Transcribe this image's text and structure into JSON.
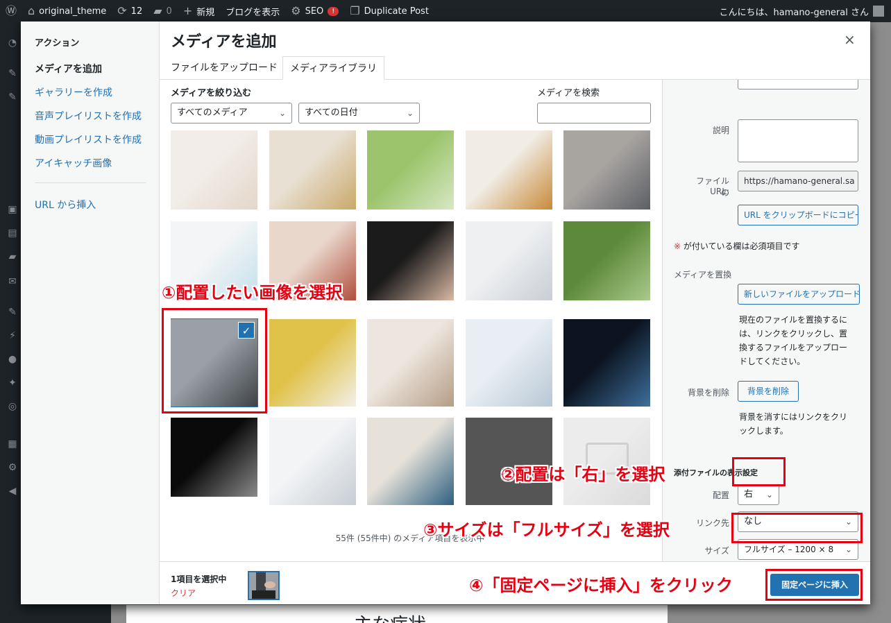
{
  "adminbar": {
    "site_name": "original_theme",
    "updates": "12",
    "comments": "0",
    "new_label": "新規",
    "view_blog": "ブログを表示",
    "seo_label": "SEO",
    "seo_badge": "!",
    "duplicate_post": "Duplicate Post",
    "greeting": "こんにちは、hamano-general さん"
  },
  "modal": {
    "title": "メディアを追加",
    "close": "×",
    "tabs": [
      {
        "label": "ファイルをアップロード"
      },
      {
        "label": "メディアライブラリ"
      }
    ]
  },
  "menu": {
    "heading": "アクション",
    "items": [
      {
        "label": "メディアを追加"
      },
      {
        "label": "ギャラリーを作成"
      },
      {
        "label": "音声プレイリストを作成"
      },
      {
        "label": "動画プレイリストを作成"
      },
      {
        "label": "アイキャッチ画像"
      },
      {
        "label": "URL から挿入"
      }
    ]
  },
  "filters": {
    "label": "メディアを絞り込む",
    "media_type": "すべてのメディア",
    "date": "すべての日付",
    "search_label": "メディアを検索",
    "search_value": ""
  },
  "library": {
    "count_text": "55件 (55件中) のメディア項目を表示中",
    "thumbnails": [
      {
        "name": "woman-sneezing",
        "colors": [
          "#f2ede8",
          "#e4d6c9"
        ]
      },
      {
        "name": "man-stairs-back-pain",
        "colors": [
          "#e8e0d2",
          "#c9a86a"
        ]
      },
      {
        "name": "elderly-man-walking",
        "colors": [
          "#9cc46c",
          "#d7e8c4"
        ]
      },
      {
        "name": "beer-and-food",
        "colors": [
          "#f1ece4",
          "#c78a3a"
        ]
      },
      {
        "name": "arm-closeup",
        "colors": [
          "#a8a4a0",
          "#5c5f66"
        ]
      },
      {
        "name": "man-jogging",
        "colors": [
          "#f3f5f7",
          "#c2e0ea"
        ]
      },
      {
        "name": "woman-eating",
        "colors": [
          "#e9d7cc",
          "#b04e3c"
        ]
      },
      {
        "name": "belly-dark",
        "colors": [
          "#1b1b1b",
          "#d9b9a5"
        ]
      },
      {
        "name": "blood-pressure",
        "colors": [
          "#eef0f2",
          "#c9ced4"
        ]
      },
      {
        "name": "couple-jogging",
        "colors": [
          "#5d8a3a",
          "#a9c98c"
        ]
      },
      {
        "name": "man-holding-stomach",
        "colors": [
          "#9aa0a6",
          "#3e4247"
        ]
      },
      {
        "name": "woman-mask-fever",
        "colors": [
          "#e0c24a",
          "#f3efe9"
        ]
      },
      {
        "name": "child-mask",
        "colors": [
          "#ede6de",
          "#b59d86"
        ]
      },
      {
        "name": "ct-scanner-room",
        "colors": [
          "#e8eef3",
          "#b8c8d6"
        ]
      },
      {
        "name": "brain-mri",
        "colors": [
          "#0b1420",
          "#3f6f9c"
        ]
      },
      {
        "name": "ct-scan-slices",
        "colors": [
          "#0a0a0a",
          "#8a8a8a"
        ]
      },
      {
        "name": "ct-machine",
        "colors": [
          "#f2f4f6",
          "#c7cdd3"
        ]
      },
      {
        "name": "hospital-corridor",
        "colors": [
          "#e7e2d9",
          "#2d5f80"
        ]
      },
      {
        "name": "gray-placeholder",
        "colors": [
          "#555555",
          "#555555"
        ]
      },
      {
        "name": "image-placeholder",
        "colors": [
          "#ececec",
          "#dadada"
        ]
      }
    ]
  },
  "sidebar": {
    "description_label": "説明",
    "file_url_label_1": "ファイルの",
    "file_url_label_2": "URL:",
    "file_url_value": "https://hamano-general.sa",
    "copy_url_button": "URL をクリップボードにコピー",
    "required_star": "※",
    "required_note": "が付いている欄は必須項目です",
    "replace_media_label": "メディアを置換",
    "upload_new_button": "新しいファイルをアップロード",
    "replace_desc_1": "現在のファイルを置換するに",
    "replace_desc_2": "は、リンクをクリックし、置",
    "replace_desc_3": "換するファイルをアップロー",
    "replace_desc_4": "ドしてください。",
    "remove_bg_label": "背景を削除",
    "remove_bg_button": "背景を削除",
    "remove_bg_desc_1": "背景を消すにはリンクをクリ",
    "remove_bg_desc_2": "ックします。",
    "display_settings_title": "添付ファイルの表示設定",
    "alignment_label": "配置",
    "alignment_value": "右",
    "link_label": "リンク先",
    "link_value": "なし",
    "size_label": "サイズ",
    "size_value": "フルサイズ – 1200 × 8"
  },
  "footer": {
    "selected_count": "1項目を選択中",
    "clear_label": "クリア",
    "insert_button": "固定ページに挿入"
  },
  "annotations": {
    "step1": "①配置したい画像を選択",
    "step2": "②配置は「右」を選択",
    "step3": "③サイズは「フルサイズ」を選択",
    "step4": "④「固定ページに挿入」をクリック"
  },
  "background": {
    "page_heading_partial": "主な症状"
  },
  "colors": {
    "accent": "#2271b1",
    "annotation_red": "#e60012",
    "required_red": "#d63638"
  }
}
